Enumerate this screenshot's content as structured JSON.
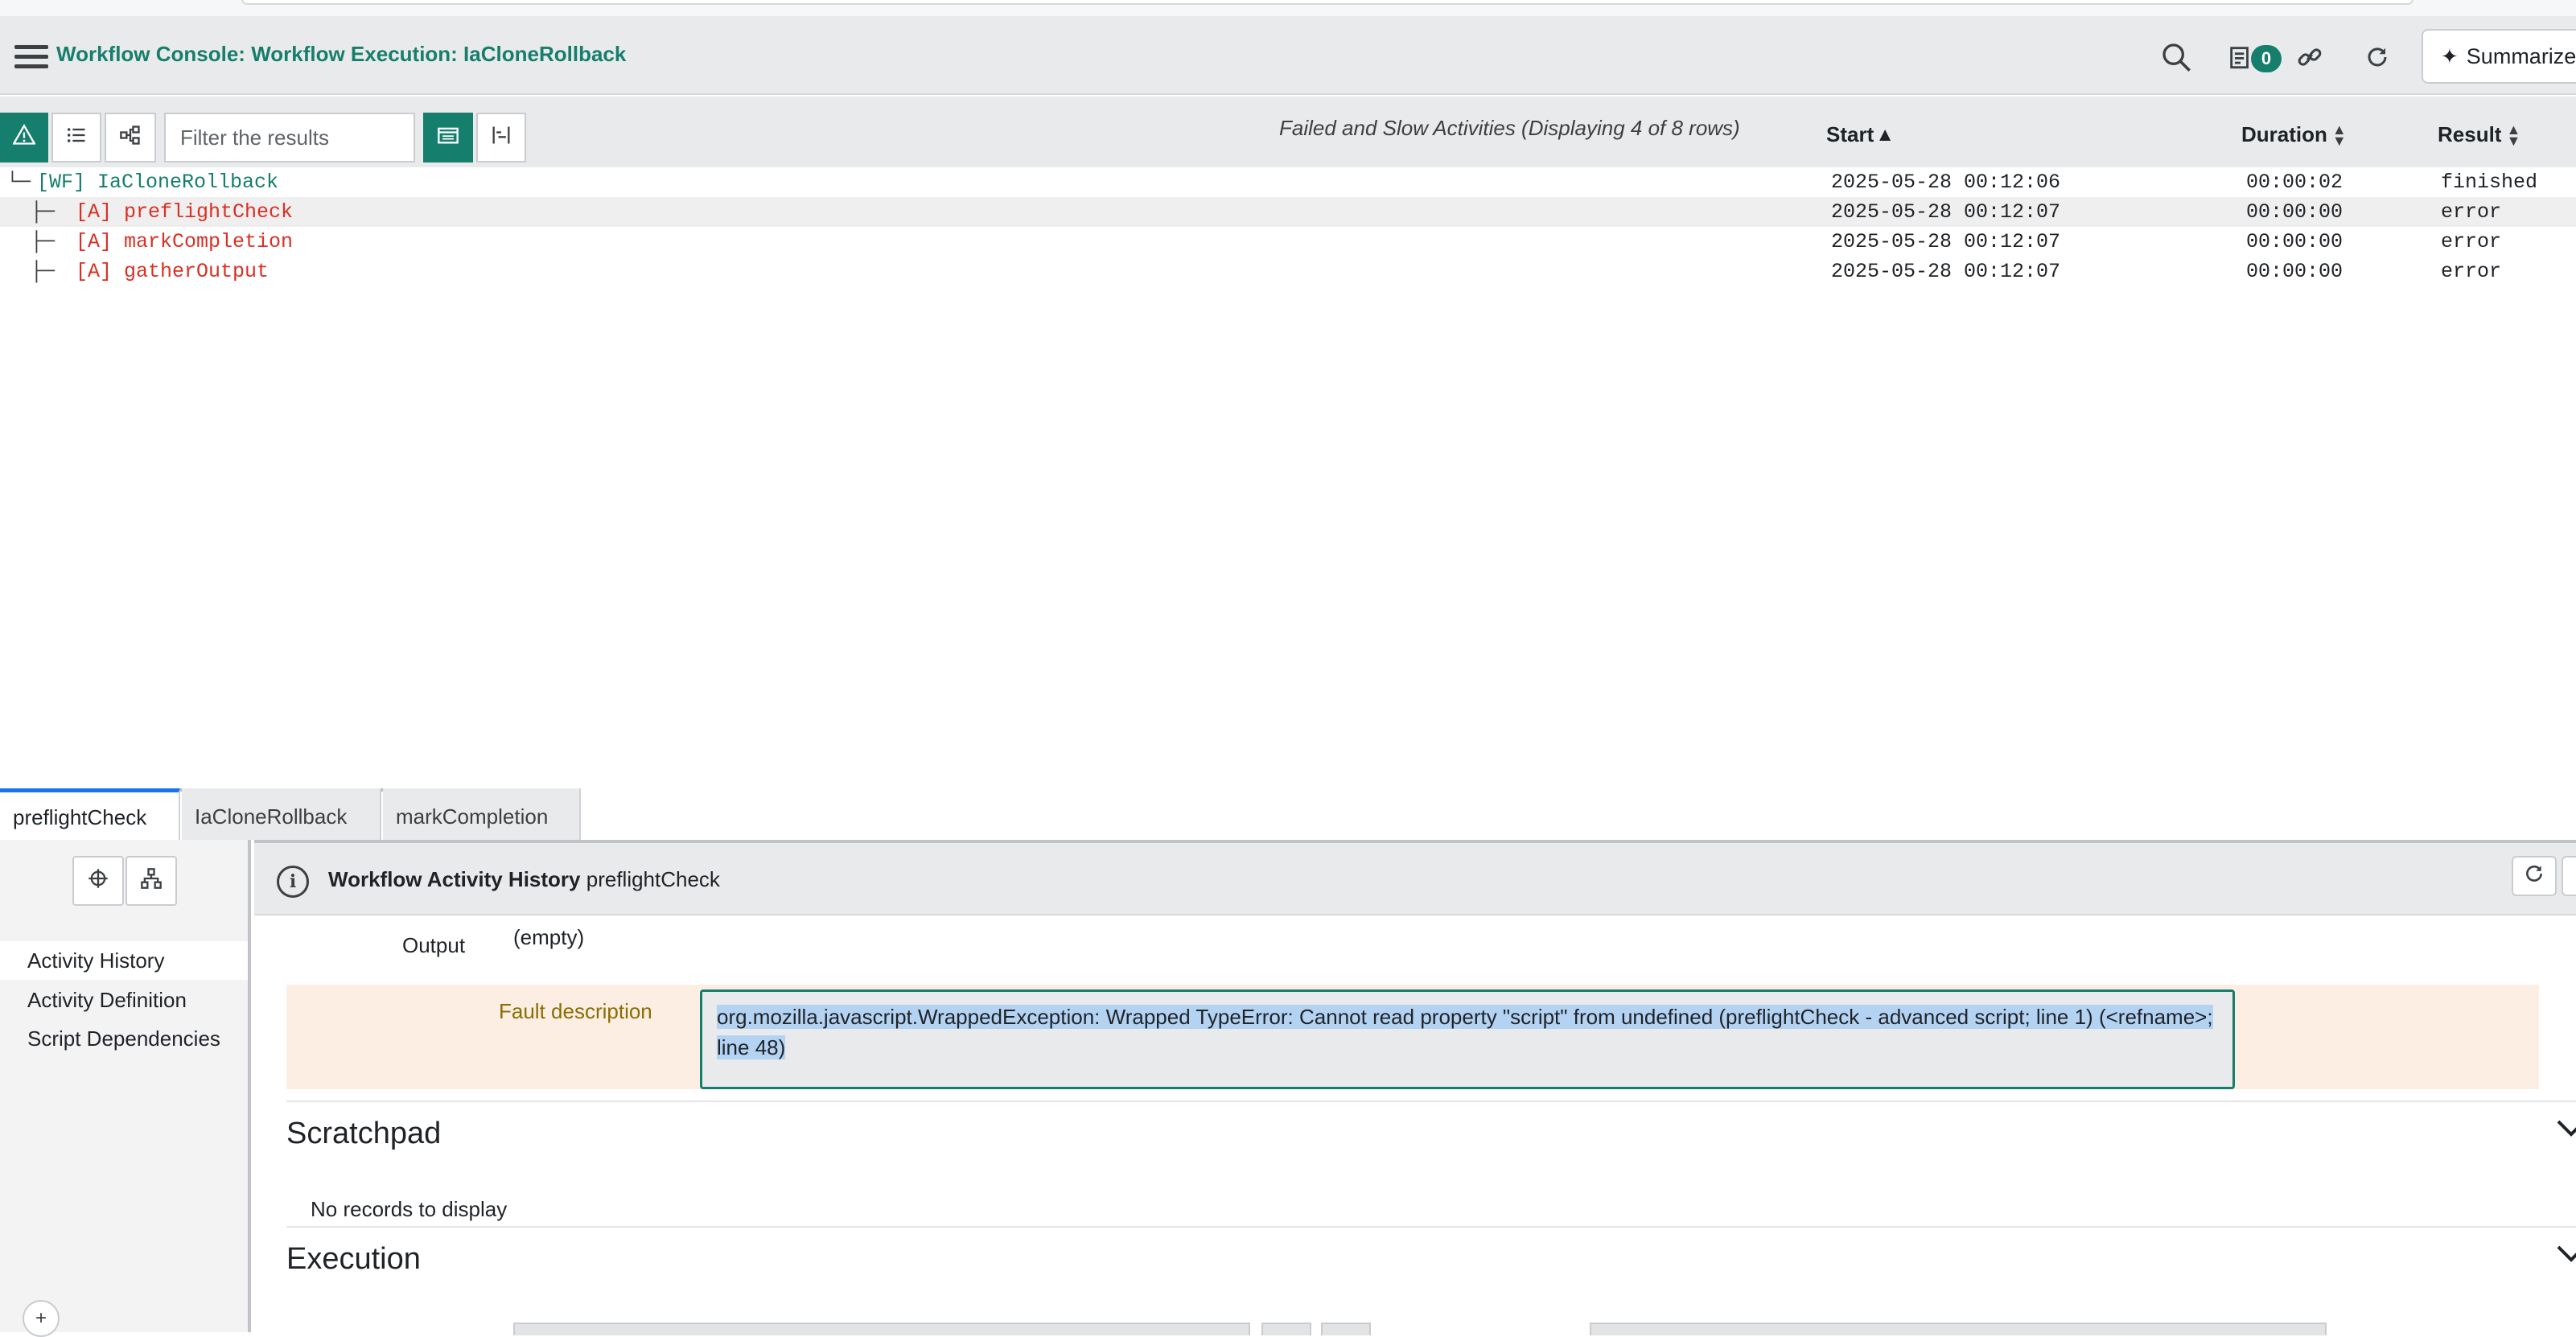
{
  "header": {
    "title": "Workflow Console: Workflow Execution: IaCloneRollback",
    "notification_count": "0",
    "summarize_label": "Summarize",
    "icons": [
      "menu-icon",
      "search-icon",
      "notifications-icon",
      "link-icon",
      "refresh-icon",
      "sparkle-icon"
    ]
  },
  "toolbar": {
    "filter_placeholder": "Filter the results",
    "caption": "Failed and Slow Activities  (Displaying 4 of 8 rows)",
    "columns": {
      "start": "Start",
      "duration": "Duration",
      "result": "Result"
    },
    "start_sort": "▲",
    "icons": [
      "warning-icon",
      "list-icon",
      "hierarchy-icon",
      "calendar-icon",
      "timeline-icon"
    ]
  },
  "rows": [
    {
      "tree": "└─",
      "name": "[WF] IaCloneRollback",
      "start": "2025-05-28 00:12:06",
      "duration": "00:00:02",
      "result": "finished"
    },
    {
      "tree": "  ├─",
      "name": "[A] preflightCheck",
      "start": "2025-05-28 00:12:07",
      "duration": "00:00:00",
      "result": "error"
    },
    {
      "tree": "  ├─",
      "name": "[A] markCompletion",
      "start": "2025-05-28 00:12:07",
      "duration": "00:00:00",
      "result": "error"
    },
    {
      "tree": "  ├─",
      "name": "[A] gatherOutput",
      "start": "2025-05-28 00:12:07",
      "duration": "00:00:00",
      "result": "error"
    }
  ],
  "tabs": [
    {
      "label": "preflightCheck",
      "active": true
    },
    {
      "label": "IaCloneRollback",
      "active": false
    },
    {
      "label": "markCompletion",
      "active": false
    }
  ],
  "left_nav": [
    "Activity History",
    "Activity Definition",
    "Script Dependencies"
  ],
  "detail": {
    "title_bold": "Workflow Activity History",
    "title_name": "preflightCheck",
    "output_label": "Output",
    "output_value": "(empty)",
    "fault_label": "Fault description",
    "fault_text": "org.mozilla.javascript.WrappedException: Wrapped TypeError: Cannot read property \"script\" from undefined (preflightCheck - advanced script; line 1) (<refname>; line 48)",
    "scratchpad_title": "Scratchpad",
    "no_records": "No records to display",
    "execution_title": "Execution"
  },
  "colors": {
    "accent": "#167e6c",
    "error": "#d93025",
    "fault_bg": "#fdeee3",
    "selection": "#b4d3f3"
  }
}
